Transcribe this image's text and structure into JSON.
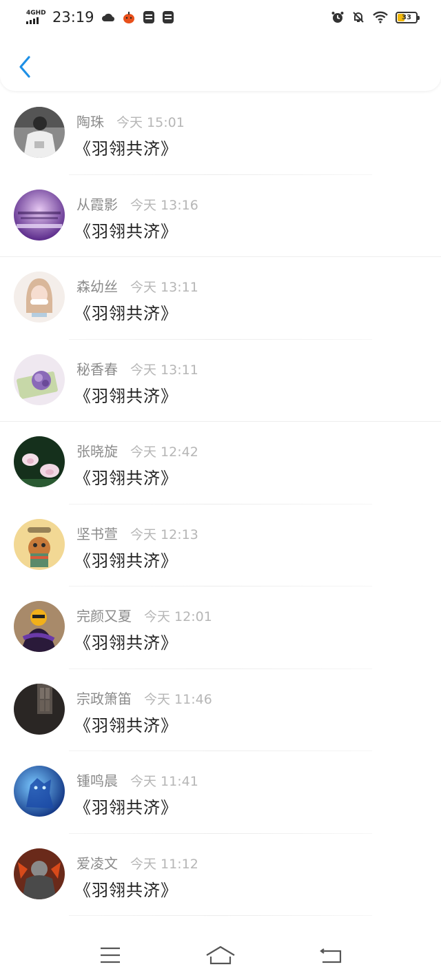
{
  "status_bar": {
    "network_label": "4GHD",
    "time": "23:19",
    "battery_level": "33"
  },
  "nav": {
    "back_icon": "chevron-left-icon"
  },
  "accent_color": "#1e90e6",
  "messages": [
    {
      "name": "陶珠",
      "time": "今天 15:01",
      "title": "《羽翎共济》"
    },
    {
      "name": "从霞影",
      "time": "今天 13:16",
      "title": "《羽翎共济》"
    },
    {
      "name": "森幼丝",
      "time": "今天 13:11",
      "title": "《羽翎共济》"
    },
    {
      "name": "秘香春",
      "time": "今天 13:11",
      "title": "《羽翎共济》"
    },
    {
      "name": "张晓旋",
      "time": "今天 12:42",
      "title": "《羽翎共济》"
    },
    {
      "name": "坚书萱",
      "time": "今天 12:13",
      "title": "《羽翎共济》"
    },
    {
      "name": "完颜又夏",
      "time": "今天 12:01",
      "title": "《羽翎共济》"
    },
    {
      "name": "宗政箫笛",
      "time": "今天 11:46",
      "title": "《羽翎共济》"
    },
    {
      "name": "锺鸣晨",
      "time": "今天 11:41",
      "title": "《羽翎共济》"
    },
    {
      "name": "爱凌文",
      "time": "今天 11:12",
      "title": "《羽翎共济》"
    }
  ],
  "system_nav": {
    "menu_icon": "menu-icon",
    "home_icon": "home-icon",
    "back_icon": "return-icon"
  }
}
